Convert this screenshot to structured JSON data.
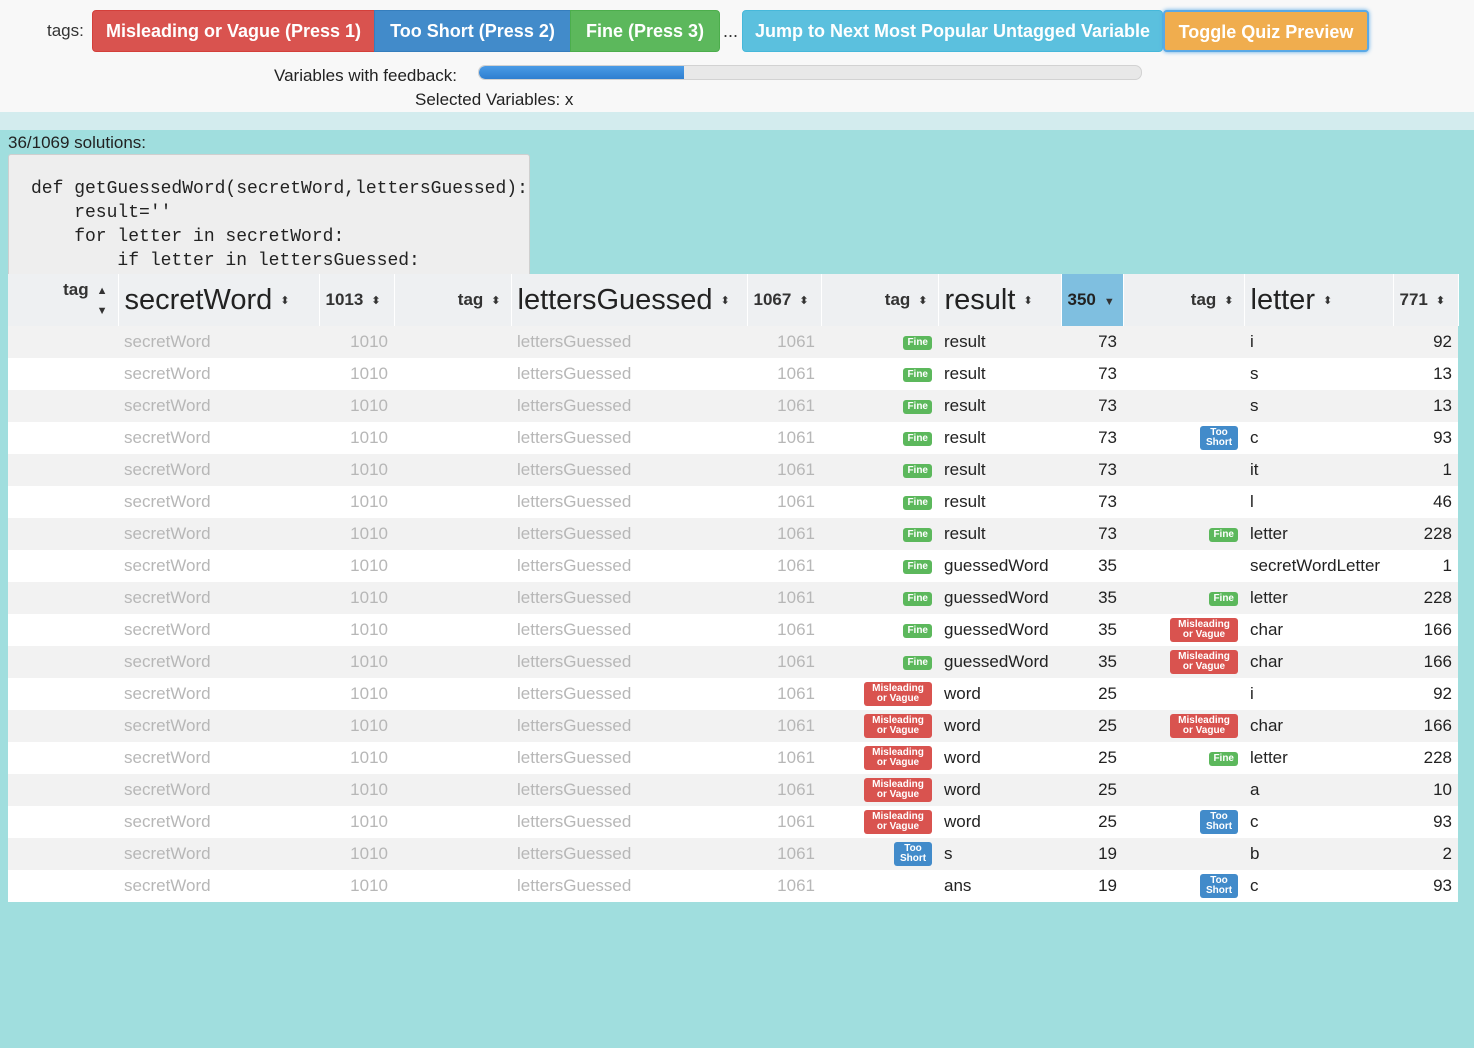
{
  "toolbar": {
    "tags_label": "tags:",
    "buttons": {
      "misleading": "Misleading or Vague (Press 1)",
      "short": "Too Short (Press 2)",
      "fine": "Fine (Press 3)",
      "ellipsis": "...",
      "jump": "Jump to Next Most Popular Untagged Variable",
      "quiz": "Toggle Quiz Preview"
    },
    "feedback_label": "Variables with feedback:",
    "feedback_progress": 0.31,
    "selected_label": "Selected Variables: x"
  },
  "colors": {
    "misleading": "#d9534f",
    "short": "#428bca",
    "fine": "#5cb85c",
    "jump": "#5bc0de",
    "quiz": "#f0ad4e",
    "panel_bg": "#a0dede"
  },
  "solutions": {
    "count_label": "36/1069 solutions:",
    "code": "def getGuessedWord(secretWord,lettersGuessed):\n    result=''\n    for letter in secretWord:\n        if letter in lettersGuessed:\n            result=result+letter\n        else:\n            result=result+'_ '\n    return result"
  },
  "table": {
    "headers": [
      {
        "tag": "tag",
        "name": "secretWord",
        "count": "1013"
      },
      {
        "tag": "tag",
        "name": "lettersGuessed",
        "count": "1067"
      },
      {
        "tag": "tag",
        "name": "result",
        "count": "350"
      },
      {
        "tag": "tag",
        "name": "letter",
        "count": "771"
      }
    ],
    "badge_labels": {
      "fine": "Fine",
      "short": "Too Short",
      "misleading": "Misleading or Vague"
    },
    "rows": [
      {
        "c1": "secretWord",
        "n1": "1010",
        "c2": "lettersGuessed",
        "n2": "1061",
        "t3": "fine",
        "c3": "result",
        "n3": "73",
        "t4": "",
        "c4": "i",
        "n4": "92"
      },
      {
        "c1": "secretWord",
        "n1": "1010",
        "c2": "lettersGuessed",
        "n2": "1061",
        "t3": "fine",
        "c3": "result",
        "n3": "73",
        "t4": "",
        "c4": "s",
        "n4": "13"
      },
      {
        "c1": "secretWord",
        "n1": "1010",
        "c2": "lettersGuessed",
        "n2": "1061",
        "t3": "fine",
        "c3": "result",
        "n3": "73",
        "t4": "",
        "c4": "s",
        "n4": "13"
      },
      {
        "c1": "secretWord",
        "n1": "1010",
        "c2": "lettersGuessed",
        "n2": "1061",
        "t3": "fine",
        "c3": "result",
        "n3": "73",
        "t4": "short",
        "c4": "c",
        "n4": "93"
      },
      {
        "c1": "secretWord",
        "n1": "1010",
        "c2": "lettersGuessed",
        "n2": "1061",
        "t3": "fine",
        "c3": "result",
        "n3": "73",
        "t4": "",
        "c4": "it",
        "n4": "1"
      },
      {
        "c1": "secretWord",
        "n1": "1010",
        "c2": "lettersGuessed",
        "n2": "1061",
        "t3": "fine",
        "c3": "result",
        "n3": "73",
        "t4": "",
        "c4": "l",
        "n4": "46"
      },
      {
        "c1": "secretWord",
        "n1": "1010",
        "c2": "lettersGuessed",
        "n2": "1061",
        "t3": "fine",
        "c3": "result",
        "n3": "73",
        "t4": "fine",
        "c4": "letter",
        "n4": "228"
      },
      {
        "c1": "secretWord",
        "n1": "1010",
        "c2": "lettersGuessed",
        "n2": "1061",
        "t3": "fine",
        "c3": "guessedWord",
        "n3": "35",
        "t4": "",
        "c4": "secretWordLetter",
        "n4": "1"
      },
      {
        "c1": "secretWord",
        "n1": "1010",
        "c2": "lettersGuessed",
        "n2": "1061",
        "t3": "fine",
        "c3": "guessedWord",
        "n3": "35",
        "t4": "fine",
        "c4": "letter",
        "n4": "228"
      },
      {
        "c1": "secretWord",
        "n1": "1010",
        "c2": "lettersGuessed",
        "n2": "1061",
        "t3": "fine",
        "c3": "guessedWord",
        "n3": "35",
        "t4": "misleading",
        "c4": "char",
        "n4": "166"
      },
      {
        "c1": "secretWord",
        "n1": "1010",
        "c2": "lettersGuessed",
        "n2": "1061",
        "t3": "fine",
        "c3": "guessedWord",
        "n3": "35",
        "t4": "misleading",
        "c4": "char",
        "n4": "166"
      },
      {
        "c1": "secretWord",
        "n1": "1010",
        "c2": "lettersGuessed",
        "n2": "1061",
        "t3": "misleading",
        "c3": "word",
        "n3": "25",
        "t4": "",
        "c4": "i",
        "n4": "92"
      },
      {
        "c1": "secretWord",
        "n1": "1010",
        "c2": "lettersGuessed",
        "n2": "1061",
        "t3": "misleading",
        "c3": "word",
        "n3": "25",
        "t4": "misleading",
        "c4": "char",
        "n4": "166"
      },
      {
        "c1": "secretWord",
        "n1": "1010",
        "c2": "lettersGuessed",
        "n2": "1061",
        "t3": "misleading",
        "c3": "word",
        "n3": "25",
        "t4": "fine",
        "c4": "letter",
        "n4": "228"
      },
      {
        "c1": "secretWord",
        "n1": "1010",
        "c2": "lettersGuessed",
        "n2": "1061",
        "t3": "misleading",
        "c3": "word",
        "n3": "25",
        "t4": "",
        "c4": "a",
        "n4": "10"
      },
      {
        "c1": "secretWord",
        "n1": "1010",
        "c2": "lettersGuessed",
        "n2": "1061",
        "t3": "misleading",
        "c3": "word",
        "n3": "25",
        "t4": "short",
        "c4": "c",
        "n4": "93"
      },
      {
        "c1": "secretWord",
        "n1": "1010",
        "c2": "lettersGuessed",
        "n2": "1061",
        "t3": "short",
        "c3": "s",
        "n3": "19",
        "t4": "",
        "c4": "b",
        "n4": "2"
      },
      {
        "c1": "secretWord",
        "n1": "1010",
        "c2": "lettersGuessed",
        "n2": "1061",
        "t3": "",
        "c3": "ans",
        "n3": "19",
        "t4": "short",
        "c4": "c",
        "n4": "93"
      }
    ]
  }
}
